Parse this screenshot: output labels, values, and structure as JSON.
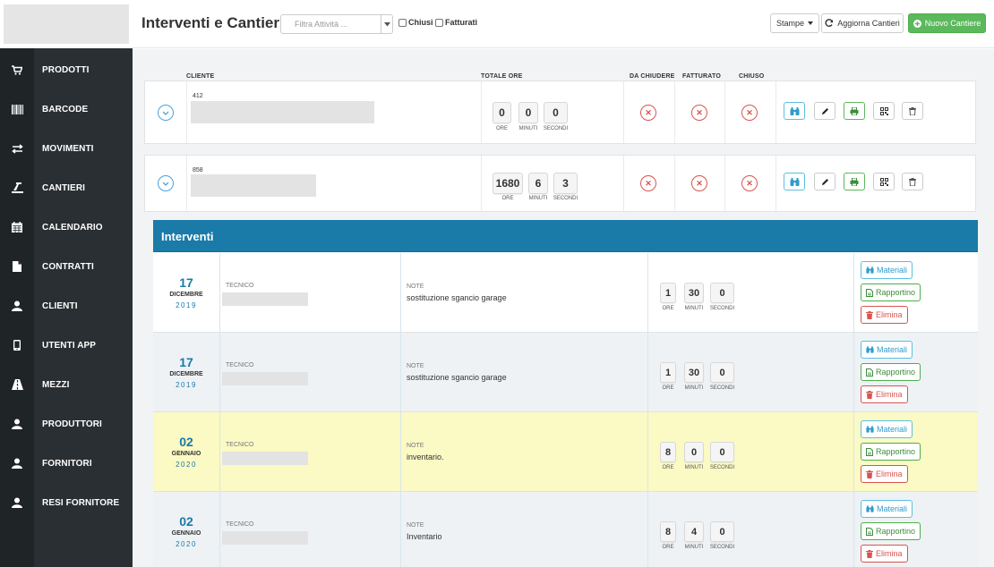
{
  "page": {
    "title": "Interventi e Cantieri"
  },
  "toolbar": {
    "filter_placeholder": "Filtra Attività ...",
    "chiusi_label": "Chiusi",
    "fatturati_label": "Fatturati",
    "stampe_label": "Stampe",
    "aggiorna_label": "Aggiorna Cantieri",
    "nuovo_label": "Nuovo Cantiere"
  },
  "sidebar": {
    "items": [
      {
        "label": "PRODOTTI",
        "icon": "cart-icon"
      },
      {
        "label": "BARCODE",
        "icon": "barcode-icon"
      },
      {
        "label": "MOVIMENTI",
        "icon": "transfer-icon"
      },
      {
        "label": "CANTIERI",
        "icon": "construction-icon"
      },
      {
        "label": "CALENDARIO",
        "icon": "calendar-icon"
      },
      {
        "label": "CONTRATTI",
        "icon": "document-icon"
      },
      {
        "label": "CLIENTI",
        "icon": "user-icon"
      },
      {
        "label": "UTENTI APP",
        "icon": "mobile-icon"
      },
      {
        "label": "MEZZI",
        "icon": "road-icon"
      },
      {
        "label": "PRODUTTORI",
        "icon": "user-icon"
      },
      {
        "label": "FORNITORI",
        "icon": "user-icon"
      },
      {
        "label": "RESI FORNITORE",
        "icon": "user-icon"
      }
    ]
  },
  "table": {
    "headers": {
      "cliente": "CLIENTE",
      "totale_ore": "TOTALE ORE",
      "da_chiudere": "DA CHIUDERE",
      "fatturato": "FATTURATO",
      "chiuso": "CHIUSO"
    },
    "time_labels": {
      "ore": "ORE",
      "minuti": "MINUTI",
      "secondi": "SECONDI"
    },
    "rows": [
      {
        "code": "412",
        "ore": "0",
        "minuti": "0",
        "secondi": "0",
        "da_chiudere": "✕",
        "fatturato": "✕",
        "chiuso": "✕"
      },
      {
        "code": "858",
        "ore": "1680",
        "minuti": "6",
        "secondi": "3",
        "da_chiudere": "✕",
        "fatturato": "✕",
        "chiuso": "✕"
      }
    ]
  },
  "interventi": {
    "title": "Interventi",
    "tecnico_label": "TECNICO",
    "note_label": "NOTE",
    "buttons": {
      "materiali": "Materiali",
      "rapportino": "Rapportino",
      "elimina": "Elimina"
    },
    "rows": [
      {
        "day": "17",
        "month": "DICEMBRE",
        "year": "2019",
        "note": "sostituzione sgancio garage",
        "ore": "1",
        "minuti": "30",
        "secondi": "0",
        "bg": "#ffffff"
      },
      {
        "day": "17",
        "month": "DICEMBRE",
        "year": "2019",
        "note": "sostituzione sgancio garage",
        "ore": "1",
        "minuti": "30",
        "secondi": "0",
        "bg": "#eef2f5"
      },
      {
        "day": "02",
        "month": "GENNAIO",
        "year": "2020",
        "note": "inventario.",
        "ore": "8",
        "minuti": "0",
        "secondi": "0",
        "bg": "#fbf9c4"
      },
      {
        "day": "02",
        "month": "GENNAIO",
        "year": "2020",
        "note": "Inventario",
        "ore": "8",
        "minuti": "4",
        "secondi": "0",
        "bg": "#eef2f5"
      }
    ]
  },
  "colors": {
    "accent": "#1a7aa8",
    "sidebar": "#2a2f33",
    "success": "#5cb85c",
    "danger": "#d9534f",
    "info": "#5bc0de"
  }
}
